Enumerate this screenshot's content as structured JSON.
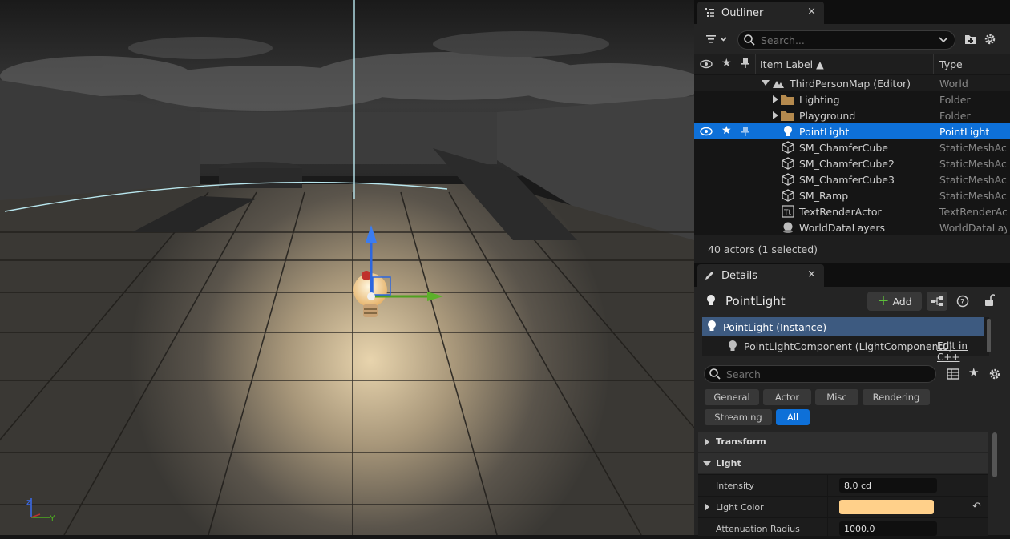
{
  "viewport": {
    "axis_z": "z",
    "axis_y": "Y"
  },
  "outliner": {
    "tab_title": "Outliner",
    "close": "×",
    "search_placeholder": "Search...",
    "columns": {
      "label": "Item Label ▲",
      "type": "Type"
    },
    "rows": [
      {
        "label": "ThirdPersonMap (Editor)",
        "type": "World",
        "icon": "world-icon"
      },
      {
        "label": "Lighting",
        "type": "Folder",
        "icon": "folder-icon"
      },
      {
        "label": "Playground",
        "type": "Folder",
        "icon": "folder-icon"
      },
      {
        "label": "PointLight",
        "type": "PointLight",
        "icon": "lightbulb-icon",
        "selected": true
      },
      {
        "label": "SM_ChamferCube",
        "type": "StaticMeshAc",
        "icon": "static-mesh-icon"
      },
      {
        "label": "SM_ChamferCube2",
        "type": "StaticMeshAc",
        "icon": "static-mesh-icon"
      },
      {
        "label": "SM_ChamferCube3",
        "type": "StaticMeshAc",
        "icon": "static-mesh-icon"
      },
      {
        "label": "SM_Ramp",
        "type": "StaticMeshAc",
        "icon": "static-mesh-icon"
      },
      {
        "label": "TextRenderActor",
        "type": "TextRenderAc",
        "icon": "text-render-icon"
      },
      {
        "label": "WorldDataLayers",
        "type": "WorldDataLay",
        "icon": "world-data-icon"
      }
    ],
    "status": "40 actors (1 selected)"
  },
  "details": {
    "tab_title": "Details",
    "close": "×",
    "actor_name": "PointLight",
    "add_label": "Add",
    "components": [
      {
        "label": "PointLight (Instance)"
      },
      {
        "label": "PointLightComponent (LightComponent0)",
        "link": "Edit in C++"
      }
    ],
    "search_placeholder": "Search",
    "filters": [
      {
        "label": "General"
      },
      {
        "label": "Actor"
      },
      {
        "label": "Misc"
      },
      {
        "label": "Rendering"
      },
      {
        "label": "Streaming"
      },
      {
        "label": "All",
        "active": true
      }
    ],
    "sections": {
      "transform": "Transform",
      "light": "Light"
    },
    "properties": [
      {
        "name": "Intensity",
        "value": "8.0 cd"
      },
      {
        "name": "Light Color",
        "value": "",
        "color": "#ffd08a"
      },
      {
        "name": "Attenuation Radius",
        "value": "1000.0"
      }
    ]
  },
  "colors": {
    "accent": "#0e70d8",
    "light_color_swatch": "#ffd08a"
  }
}
